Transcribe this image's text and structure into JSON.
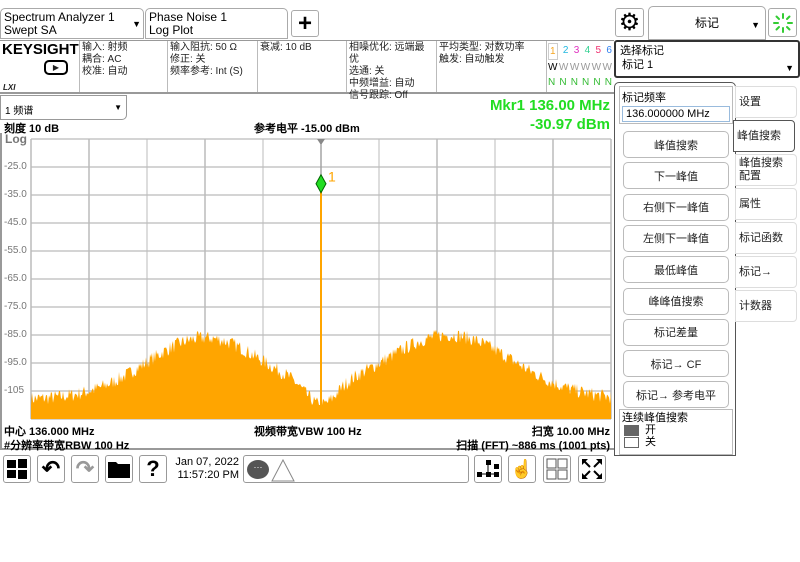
{
  "tabs": [
    {
      "line1": "Spectrum Analyzer 1",
      "line2": "Swept SA"
    },
    {
      "line1": "Phase Noise 1",
      "line2": "Log Plot"
    }
  ],
  "add_tab_label": "+",
  "mode_menu": {
    "label": "标记"
  },
  "brand": "KEYSIGHT",
  "lxi": "LXI",
  "info": {
    "col1": [
      "输入: 射频",
      "耦合: AC",
      "校准: 自动"
    ],
    "col2": [
      "输入阻抗: 50 Ω",
      "修正: 关",
      "频率参考: Int (S)"
    ],
    "col3": [
      "衰减: 10 dB"
    ],
    "col4": [
      "相噪优化: 远端最优",
      "选通: 关",
      "中频增益: 自动",
      "信号跟踪: Off"
    ],
    "col5": [
      "平均类型: 对数功率",
      "触发: 自动触发"
    ]
  },
  "traces": {
    "numbers": [
      "1",
      "2",
      "3",
      "4",
      "5",
      "6"
    ],
    "colors": [
      "#f5a623",
      "#22b8e0",
      "#e030c0",
      "#30d090",
      "#f03070",
      "#3080f0"
    ],
    "types": [
      "W",
      "W",
      "W",
      "W",
      "W",
      "W"
    ],
    "dets": [
      "N",
      "N",
      "N",
      "N",
      "N",
      "N"
    ]
  },
  "select_marker": {
    "label": "选择标记",
    "value": "标记 1"
  },
  "window_select": "1 频谱",
  "marker_readout": {
    "freq": "Mkr1  136.00 MHz",
    "amp": "-30.97 dBm",
    "color": "#22dd22"
  },
  "scale": "刻度 10 dB",
  "ref_level": "参考电平 -15.00 dBm",
  "scale_type": "Log",
  "chart_data": {
    "type": "area",
    "ylim": [
      -115,
      -15
    ],
    "y_ticks": [
      "-25.0",
      "-35.0",
      "-45.0",
      "-55.0",
      "-65.0",
      "-75.0",
      "-85.0",
      "-95.0",
      "-105"
    ],
    "x_range_mhz": [
      131,
      141
    ],
    "grid": true,
    "trace_color": "#ffa500",
    "marker": {
      "label": "1",
      "x_mhz": 136.0,
      "y_dbm": -30.97,
      "color": "#22dd22"
    }
  },
  "footer": {
    "center": "中心 136.000 MHz",
    "vbw": "视频带宽VBW 100 Hz",
    "span": "扫宽 10.00 MHz",
    "rbw": "#分辨率带宽RBW 100 Hz",
    "sweep": "扫描 (FFT) ~886 ms (1001 pts)"
  },
  "softkeys": {
    "marker_freq_label": "标记频率",
    "marker_freq_value": "136.000000 MHz",
    "buttons": [
      "峰值搜索",
      "下一峰值",
      "右侧下一峰值",
      "左侧下一峰值",
      "最低峰值",
      "峰峰值搜索",
      "标记差量",
      "标记→ CF",
      "标记→ 参考电平"
    ],
    "continuous": {
      "label": "连续峰值搜索",
      "on": "开",
      "off": "关",
      "state": "on"
    }
  },
  "menu_tabs": [
    "设置",
    "峰值搜索",
    "峰值搜索配置",
    "属性",
    "标记函数",
    "标记→",
    "计数器"
  ],
  "taskbar": {
    "date": "Jan 07, 2022",
    "time": "11:57:20 PM"
  }
}
